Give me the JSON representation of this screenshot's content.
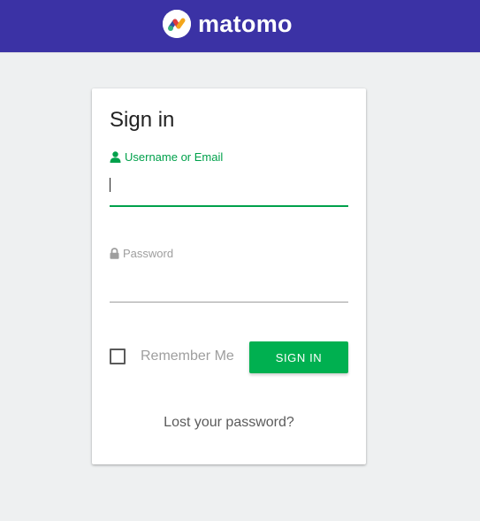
{
  "header": {
    "brand_name": "matomo",
    "logo_icon": "matomo-logo-icon",
    "background_color": "#3b32a5"
  },
  "login": {
    "title": "Sign in",
    "username_label": "Username or Email",
    "username_value": "",
    "password_label": "Password",
    "password_value": "",
    "remember_label": "Remember Me",
    "remember_checked": false,
    "sign_in_label": "SIGN IN",
    "lost_password_label": "Lost your password?"
  },
  "colors": {
    "accent": "#00a14b",
    "button": "#00b050",
    "muted": "#9e9e9e"
  }
}
